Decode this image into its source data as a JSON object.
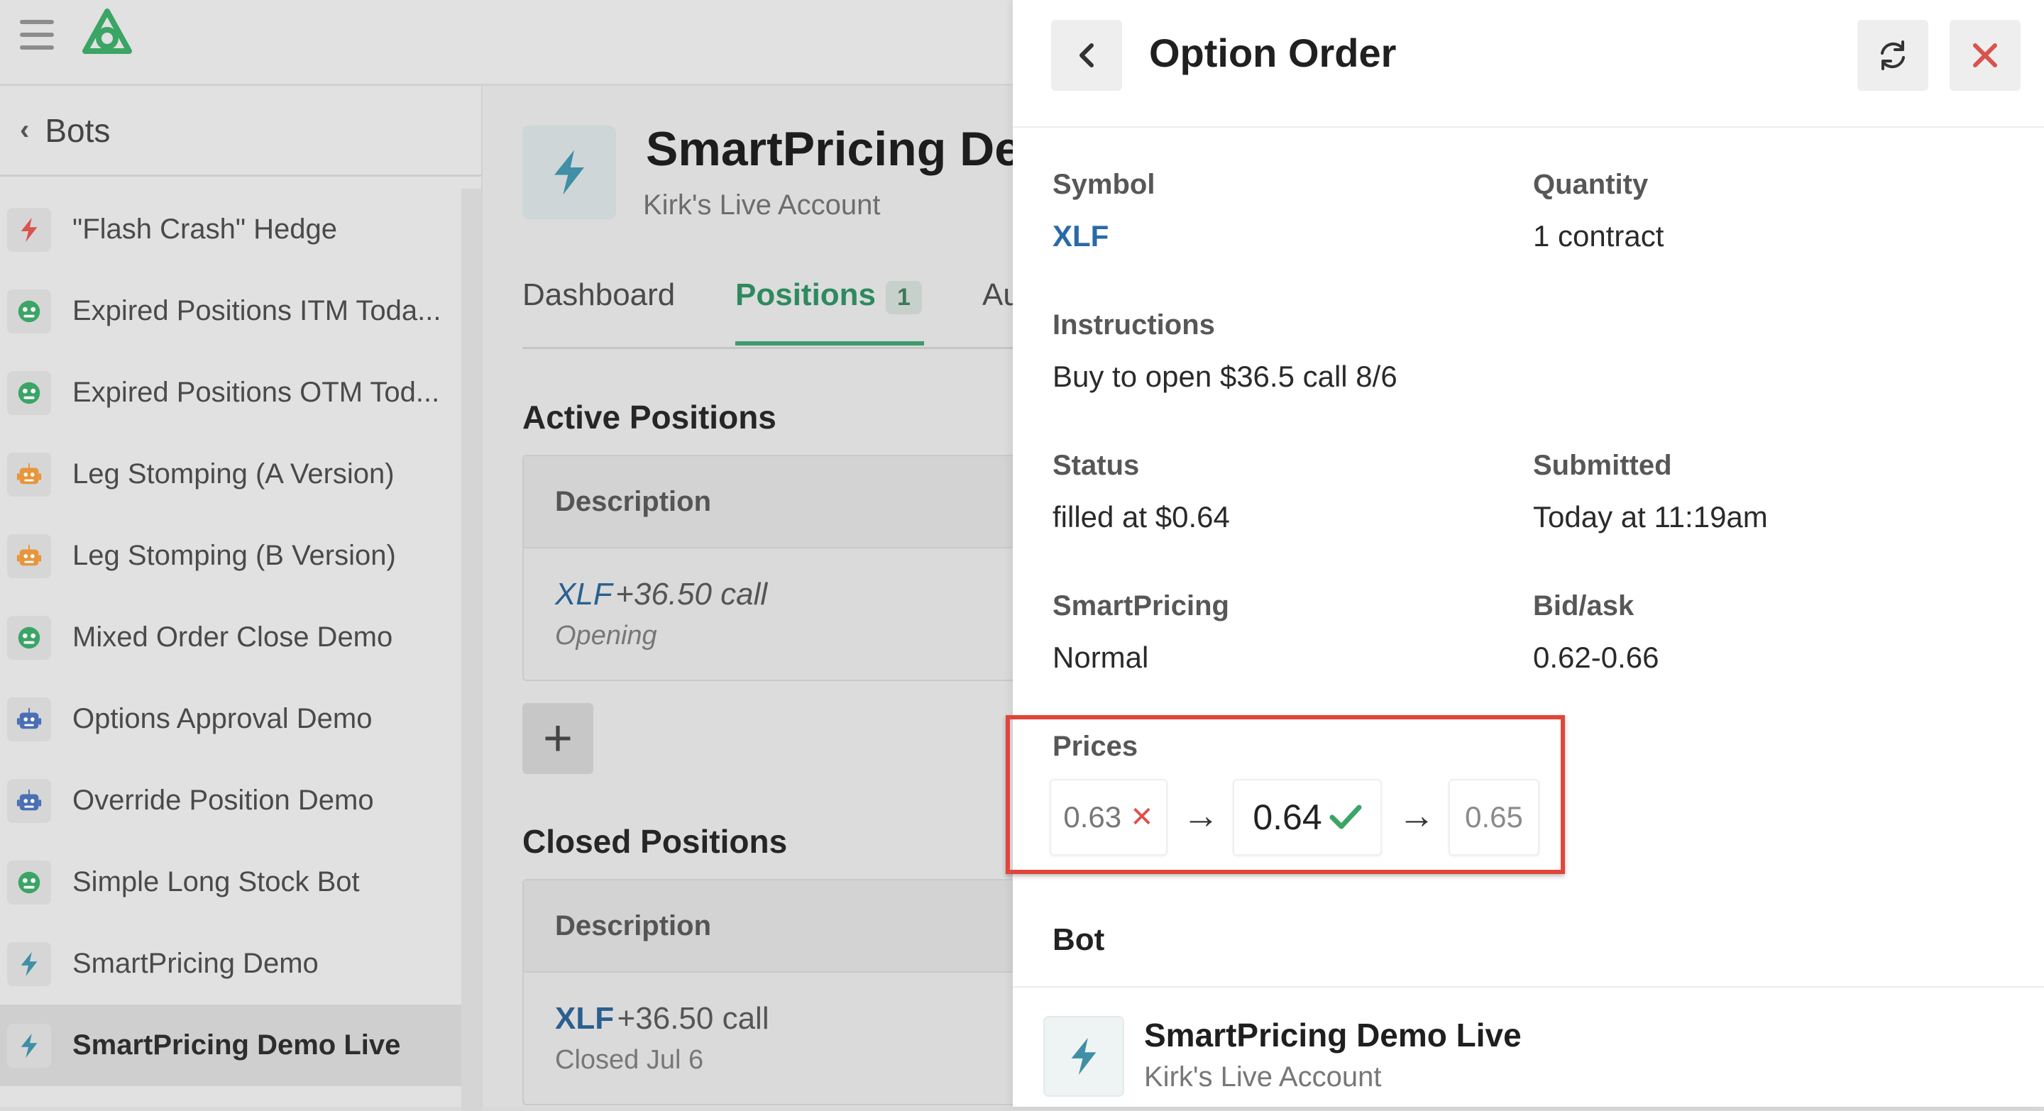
{
  "sidebar": {
    "back_label": "Bots",
    "items": [
      {
        "label": "\"Flash Crash\" Hedge",
        "icon": "flash-icon",
        "icon_color": "#d9534f"
      },
      {
        "label": "Expired Positions ITM Toda...",
        "icon": "robot-face-icon",
        "icon_color": "#3aa565"
      },
      {
        "label": "Expired Positions OTM Tod...",
        "icon": "robot-face-icon",
        "icon_color": "#3aa565"
      },
      {
        "label": "Leg Stomping (A Version)",
        "icon": "robot-icon",
        "icon_color": "#e8953c"
      },
      {
        "label": "Leg Stomping (B Version)",
        "icon": "robot-icon",
        "icon_color": "#e8953c"
      },
      {
        "label": "Mixed Order Close Demo",
        "icon": "robot-face-icon",
        "icon_color": "#3aa565"
      },
      {
        "label": "Options Approval Demo",
        "icon": "robot-icon",
        "icon_color": "#4a6fb5"
      },
      {
        "label": "Override Position Demo",
        "icon": "robot-icon",
        "icon_color": "#4a6fb5"
      },
      {
        "label": "Simple Long Stock Bot",
        "icon": "robot-face-icon",
        "icon_color": "#3aa565"
      },
      {
        "label": "SmartPricing Demo",
        "icon": "flash-icon",
        "icon_color": "#3f8fa6"
      },
      {
        "label": "SmartPricing Demo Live",
        "icon": "flash-icon",
        "icon_color": "#3f8fa6",
        "selected": true
      }
    ]
  },
  "main": {
    "title": "SmartPricing De",
    "account": "Kirk's Live Account",
    "tabs": [
      {
        "label": "Dashboard"
      },
      {
        "label": "Positions",
        "badge": "1",
        "active": true
      },
      {
        "label": "Au"
      }
    ],
    "active_positions": {
      "heading": "Active Positions",
      "column": "Description",
      "rows": [
        {
          "symbol": "XLF",
          "detail": "+36.50 call",
          "status": "Opening"
        }
      ]
    },
    "closed_positions": {
      "heading": "Closed Positions",
      "column": "Description",
      "rows": [
        {
          "symbol": "XLF",
          "detail": "+36.50 call",
          "status": "Closed Jul 6"
        }
      ]
    }
  },
  "drawer": {
    "title": "Option Order",
    "fields": {
      "symbol": {
        "label": "Symbol",
        "value": "XLF"
      },
      "quantity": {
        "label": "Quantity",
        "value": "1 contract"
      },
      "instructions": {
        "label": "Instructions",
        "value": "Buy to open $36.5 call 8/6"
      },
      "status": {
        "label": "Status",
        "value": "filled at $0.64"
      },
      "submitted": {
        "label": "Submitted",
        "value": "Today at 11:19am"
      },
      "smartpricing": {
        "label": "SmartPricing",
        "value": "Normal"
      },
      "bidask": {
        "label": "Bid/ask",
        "value": "0.62-0.66"
      }
    },
    "prices": {
      "label": "Prices",
      "steps": [
        {
          "value": "0.63",
          "result": "rejected"
        },
        {
          "value": "0.64",
          "result": "filled"
        },
        {
          "value": "0.65",
          "result": "pending"
        }
      ],
      "arrow": "→"
    },
    "bot": {
      "heading": "Bot",
      "name": "SmartPricing Demo Live",
      "account": "Kirk's Live Account"
    }
  },
  "colors": {
    "accent_green": "#3d9a6b",
    "link_blue": "#2a6aa8",
    "highlight_red": "#e0463a",
    "close_red": "#d9534f"
  }
}
